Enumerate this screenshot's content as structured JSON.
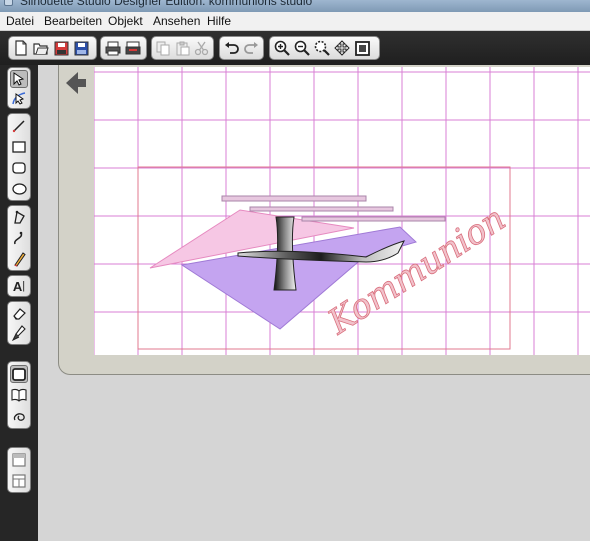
{
  "window": {
    "title": "Silhouette Studio Designer Edition: kommunions studio"
  },
  "menu": {
    "items": [
      "Datei",
      "Bearbeiten",
      "Objekt",
      "Ansehen",
      "Hilfe"
    ]
  },
  "toolbar": {
    "groups": [
      [
        "new-document",
        "open-folder",
        "save",
        "save-to-library"
      ],
      [
        "print",
        "print-cut"
      ],
      [
        "copy",
        "paste",
        "cut"
      ],
      [
        "undo",
        "redo"
      ],
      [
        "zoom-in",
        "zoom-out",
        "zoom-select",
        "pan",
        "fit-page"
      ]
    ]
  },
  "tools": {
    "groups": [
      [
        "select-pointer",
        "edit-points"
      ],
      [
        "draw-line",
        "draw-rectangle",
        "draw-rounded-rectangle",
        "draw-ellipse"
      ],
      [
        "draw-polygon",
        "draw-curve",
        "freehand-pencil"
      ],
      [
        "text-tool"
      ],
      [
        "eraser",
        "knife"
      ],
      [
        "cut-settings",
        "library",
        "trace"
      ],
      [
        "page-setup",
        "split-view"
      ]
    ]
  },
  "canvas": {
    "script_text": "Kommunion",
    "colors": {
      "grid": "#d97fd4",
      "cut_border": "#e07a8f",
      "pink_shape": "#f6c7e4",
      "purple_shape": "#c4a4f0",
      "script_color": "#d9707e",
      "cross_dark": "#1f1f1f",
      "cross_light": "#d8d8d8"
    }
  }
}
